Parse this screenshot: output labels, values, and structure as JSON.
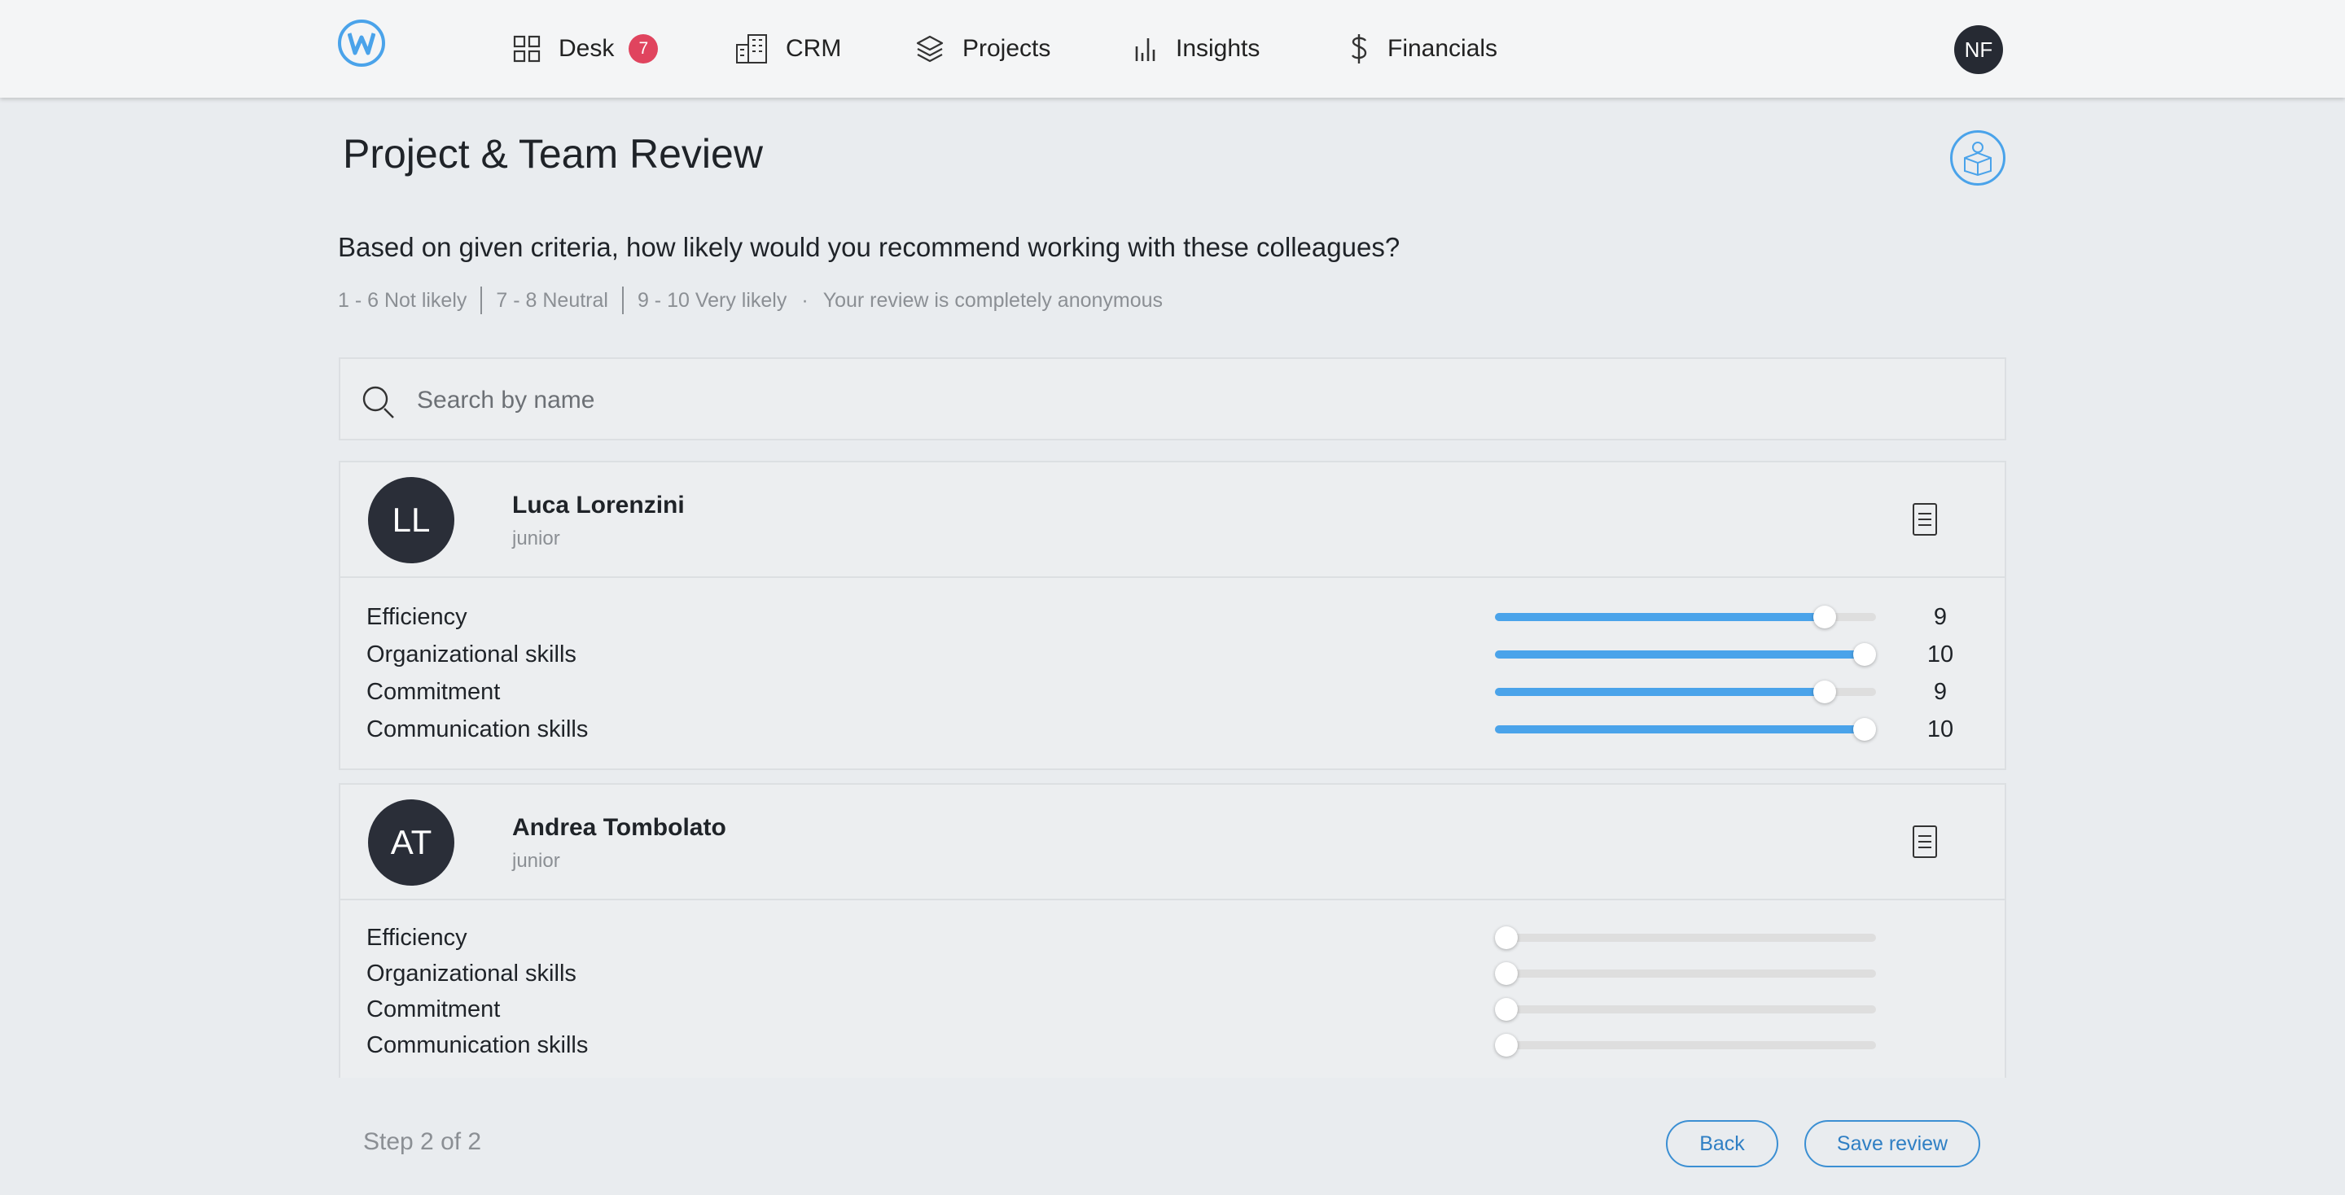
{
  "nav": {
    "logo_letter": "W",
    "items": [
      {
        "label": "Desk",
        "icon": "grid-icon",
        "badge": "7"
      },
      {
        "label": "CRM",
        "icon": "building-icon"
      },
      {
        "label": "Projects",
        "icon": "layers-icon"
      },
      {
        "label": "Insights",
        "icon": "bar-chart-icon"
      },
      {
        "label": "Financials",
        "icon": "dollar-icon"
      }
    ],
    "user_initials": "NF"
  },
  "page": {
    "title": "Project & Team Review",
    "question": "Based on given criteria, how likely would you recommend working with these colleagues?",
    "legend": {
      "not_likely": "1 - 6 Not likely",
      "neutral": "7 - 8 Neutral",
      "very_likely": "9 - 10 Very likely",
      "dot": "·",
      "anonymous": "Your review is completely anonymous"
    }
  },
  "search": {
    "placeholder": "Search by name",
    "value": ""
  },
  "slider_scale": {
    "min": 1,
    "max": 10
  },
  "colleagues": [
    {
      "initials": "LL",
      "name": "Luca Lorenzini",
      "role": "junior",
      "criteria": [
        {
          "label": "Efficiency",
          "value": "9"
        },
        {
          "label": "Organizational skills",
          "value": "10"
        },
        {
          "label": "Commitment",
          "value": "9"
        },
        {
          "label": "Communication skills",
          "value": "10"
        }
      ]
    },
    {
      "initials": "AT",
      "name": "Andrea Tombolato",
      "role": "junior",
      "criteria": [
        {
          "label": "Efficiency",
          "value": ""
        },
        {
          "label": "Organizational skills",
          "value": ""
        },
        {
          "label": "Commitment",
          "value": ""
        },
        {
          "label": "Communication skills",
          "value": ""
        }
      ]
    }
  ],
  "footer": {
    "step": "Step 2 of 2",
    "back_label": "Back",
    "save_label": "Save review"
  },
  "colors": {
    "accent": "#4aa3ea",
    "badge": "#e0445e",
    "avatar": "#2a2e38"
  }
}
